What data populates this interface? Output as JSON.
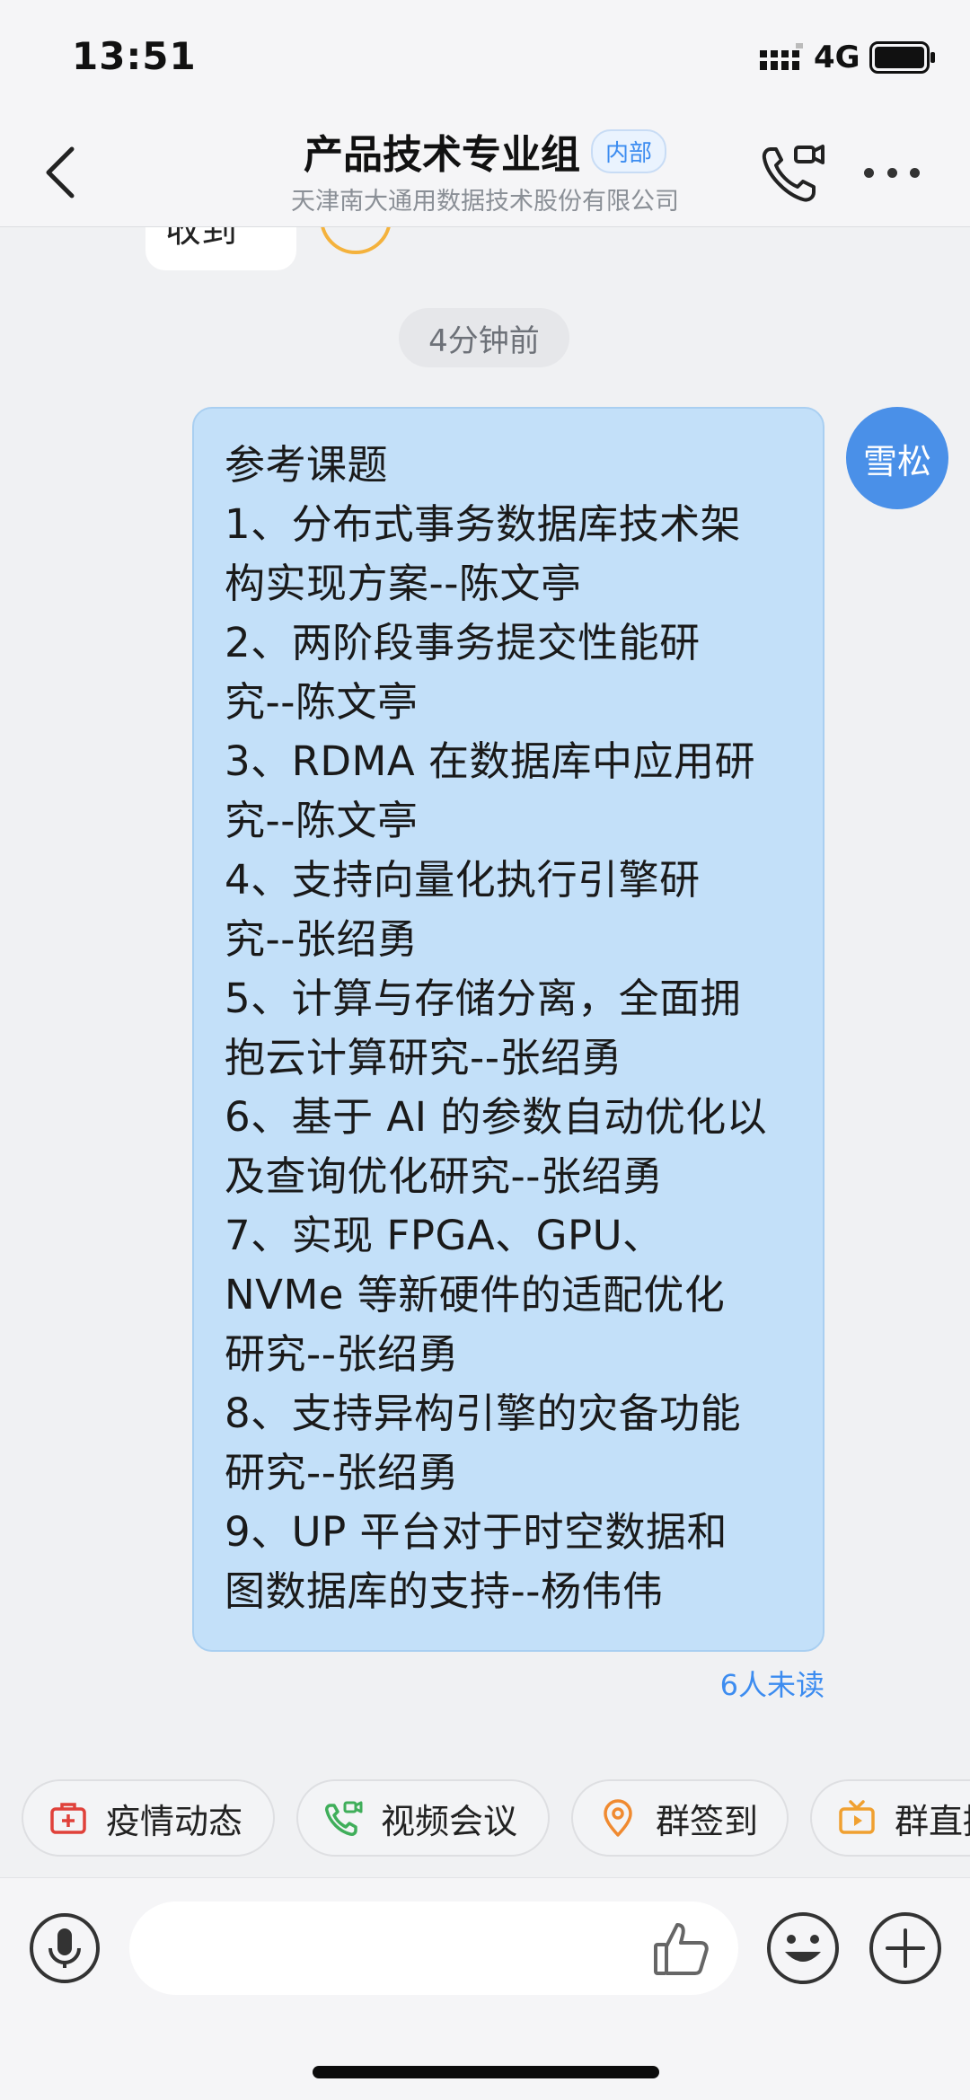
{
  "status_bar": {
    "time": "13:51",
    "network": "4G"
  },
  "header": {
    "title": "产品技术专业组",
    "badge": "内部",
    "subtitle": "天津南大通用数据技术股份有限公司"
  },
  "chat": {
    "previous_message_fragment": "收到",
    "timestamp": "4分钟前",
    "message": {
      "sender_avatar_text": "雪松",
      "lines": [
        "参考课题",
        "1、分布式事务数据库技术架",
        "构实现方案--陈文亭",
        "2、两阶段事务提交性能研",
        "究--陈文亭",
        "3、RDMA 在数据库中应用研",
        "究--陈文亭",
        "4、支持向量化执行引擎研",
        "究--张绍勇",
        "5、计算与存储分离，全面拥",
        "抱云计算研究--张绍勇",
        "6、基于 AI 的参数自动优化以",
        "及查询优化研究--张绍勇",
        "7、实现 FPGA、GPU、",
        "NVMe 等新硬件的适配优化",
        "研究--张绍勇",
        "8、支持异构引擎的灾备功能",
        "研究--张绍勇",
        "9、UP 平台对于时空数据和",
        "图数据库的支持--杨伟伟"
      ],
      "read_status": "6人未读"
    }
  },
  "quick_actions": [
    {
      "label": "疫情动态",
      "icon": "medical-kit-icon",
      "color": "#e0413a"
    },
    {
      "label": "视频会议",
      "icon": "video-call-icon",
      "color": "#3fae5a"
    },
    {
      "label": "群签到",
      "icon": "location-pin-icon",
      "color": "#f08a30"
    },
    {
      "label": "群直播",
      "icon": "tv-live-icon",
      "color": "#f0a030"
    }
  ],
  "input": {
    "placeholder": ""
  },
  "colors": {
    "accent": "#3c8cf0",
    "bubble_self": "#c3e0f9",
    "avatar": "#4a90e8"
  }
}
